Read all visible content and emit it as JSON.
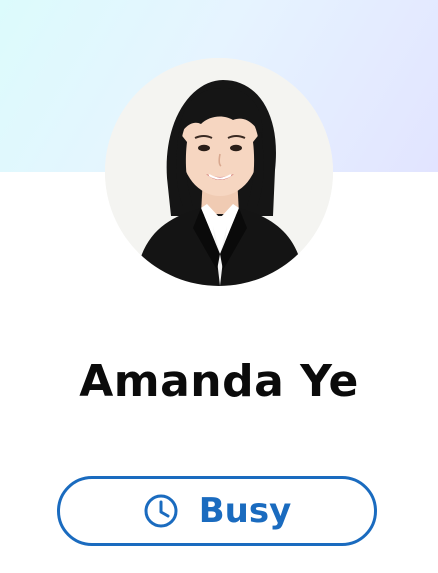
{
  "profile": {
    "name": "Amanda Ye",
    "photo": "profile-photo"
  },
  "status": {
    "label": "Busy",
    "icon": "clock-icon",
    "color": "#1a6bbf"
  },
  "theme": {
    "banner_gradient": [
      "#dcfbfc",
      "#e6f4ff",
      "#e2e4ff"
    ]
  }
}
